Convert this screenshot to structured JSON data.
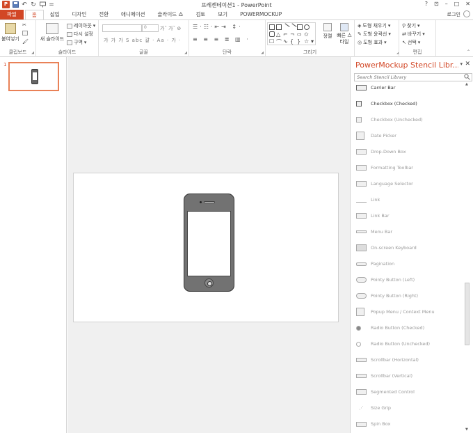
{
  "window": {
    "title": "프레젠테이션1 - PowerPoint",
    "logo": "P",
    "help": "?",
    "restore_ribbon": "⊡",
    "minimize": "–",
    "maximize": "□",
    "close": "✕",
    "user": "로그인"
  },
  "qat": {
    "save_icon": "save-icon",
    "undo_icon": "undo-icon",
    "redo_icon": "redo-icon",
    "presenter_icon": "slideshow-icon",
    "more": "="
  },
  "tabs": [
    "파일",
    "홈",
    "삽입",
    "디자인",
    "전환",
    "애니메이션",
    "슬라이드 쇼",
    "검토",
    "보기",
    "POWERMOCKUP"
  ],
  "ribbon": {
    "clipboard": {
      "label": "클립보드",
      "paste": "붙여넣기"
    },
    "slides": {
      "label": "슬라이드",
      "new_slide": "새 슬라이드",
      "layout": "레이아웃",
      "reset": "다시 설정",
      "section": "구역"
    },
    "font": {
      "label": "글꼴",
      "size": "0",
      "buttons": "가 가 가 S abc 갈 · Aa · 가 ·"
    },
    "paragraph": {
      "label": "단락"
    },
    "drawing": {
      "label": "그리기",
      "arrange": "정렬",
      "quick_styles": "빠른 스타일",
      "fill": "도형 채우기",
      "outline": "도형 윤곽선",
      "effects": "도형 효과"
    },
    "editing": {
      "label": "편집",
      "find": "찾기",
      "replace": "바꾸기",
      "select": "선택"
    }
  },
  "slides_pane": {
    "slide_number": "1"
  },
  "panel": {
    "title": "PowerMockup Stencil Libr...",
    "pin": "▾",
    "close": "✕",
    "search_placeholder": "Search Stencil Library",
    "items": [
      "Carrier Bar",
      "Checkbox (Checked)",
      "Checkbox (Unchecked)",
      "Date Picker",
      "Drop-Down Box",
      "Formatting Toolbar",
      "Language Selector",
      "Link",
      "Link Bar",
      "Menu Bar",
      "On-screen Keyboard",
      "Pagination",
      "Pointy Button (Left)",
      "Pointy Button (Right)",
      "Popup Menu / Context Menu",
      "Radio Button (Checked)",
      "Radio Button (Unchecked)",
      "Scrollbar (Horizontal)",
      "Scrollbar (Vertical)",
      "Segmented Control",
      "Size Grip",
      "Spin Box"
    ]
  },
  "colors": {
    "accent": "#d24726",
    "thumb_border": "#e98157"
  }
}
